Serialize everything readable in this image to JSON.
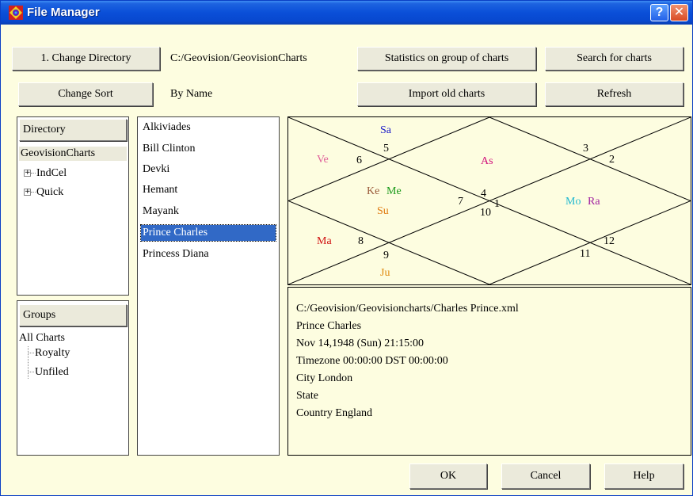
{
  "window": {
    "title": "File Manager"
  },
  "toolbar": {
    "change_directory": "1. Change Directory",
    "path": "C:/Geovision/GeovisionCharts",
    "statistics": "Statistics on group of charts",
    "search": "Search for charts",
    "change_sort": "Change Sort",
    "sort_value": "By Name",
    "import": "Import old charts",
    "refresh": "Refresh"
  },
  "directory": {
    "header": "Directory",
    "root": "GeovisionCharts",
    "items": [
      "IndCel",
      "Quick"
    ]
  },
  "groups": {
    "header": "Groups",
    "root": "All Charts",
    "items": [
      "Royalty",
      "Unfiled"
    ]
  },
  "charts": {
    "items": [
      "Alkiviades",
      "Bill Clinton",
      "Devki",
      "Hemant",
      "Mayank",
      "Prince Charles",
      "Princess Diana"
    ],
    "selected": "Prince Charles"
  },
  "chart": {
    "houses": [
      "1",
      "2",
      "3",
      "4",
      "5",
      "6",
      "7",
      "8",
      "9",
      "10",
      "11",
      "12"
    ],
    "planets": {
      "sa": "Sa",
      "ve": "Ve",
      "as": "As",
      "ke": "Ke",
      "me": "Me",
      "su": "Su",
      "mo": "Mo",
      "ra": "Ra",
      "ma": "Ma",
      "ju": "Ju"
    },
    "colors": {
      "sa": "#1a1ac8",
      "ve": "#e0609a",
      "as": "#d0107a",
      "ke": "#9a5a3a",
      "me": "#1a9a1a",
      "su": "#e07a10",
      "mo": "#20b8d0",
      "ra": "#a020a0",
      "ma": "#d01010",
      "ju": "#e08a10"
    }
  },
  "info": {
    "file": "C:/Geovision/Geovisioncharts/Charles Prince.xml",
    "name": "Prince Charles",
    "date": "Nov 14,1948  (Sun)    21:15:00",
    "timezone": "Timezone 00:00:00  DST 00:00:00",
    "city": "City  London",
    "state": "State",
    "country": "Country  England"
  },
  "footer": {
    "ok": "OK",
    "cancel": "Cancel",
    "help": "Help"
  }
}
